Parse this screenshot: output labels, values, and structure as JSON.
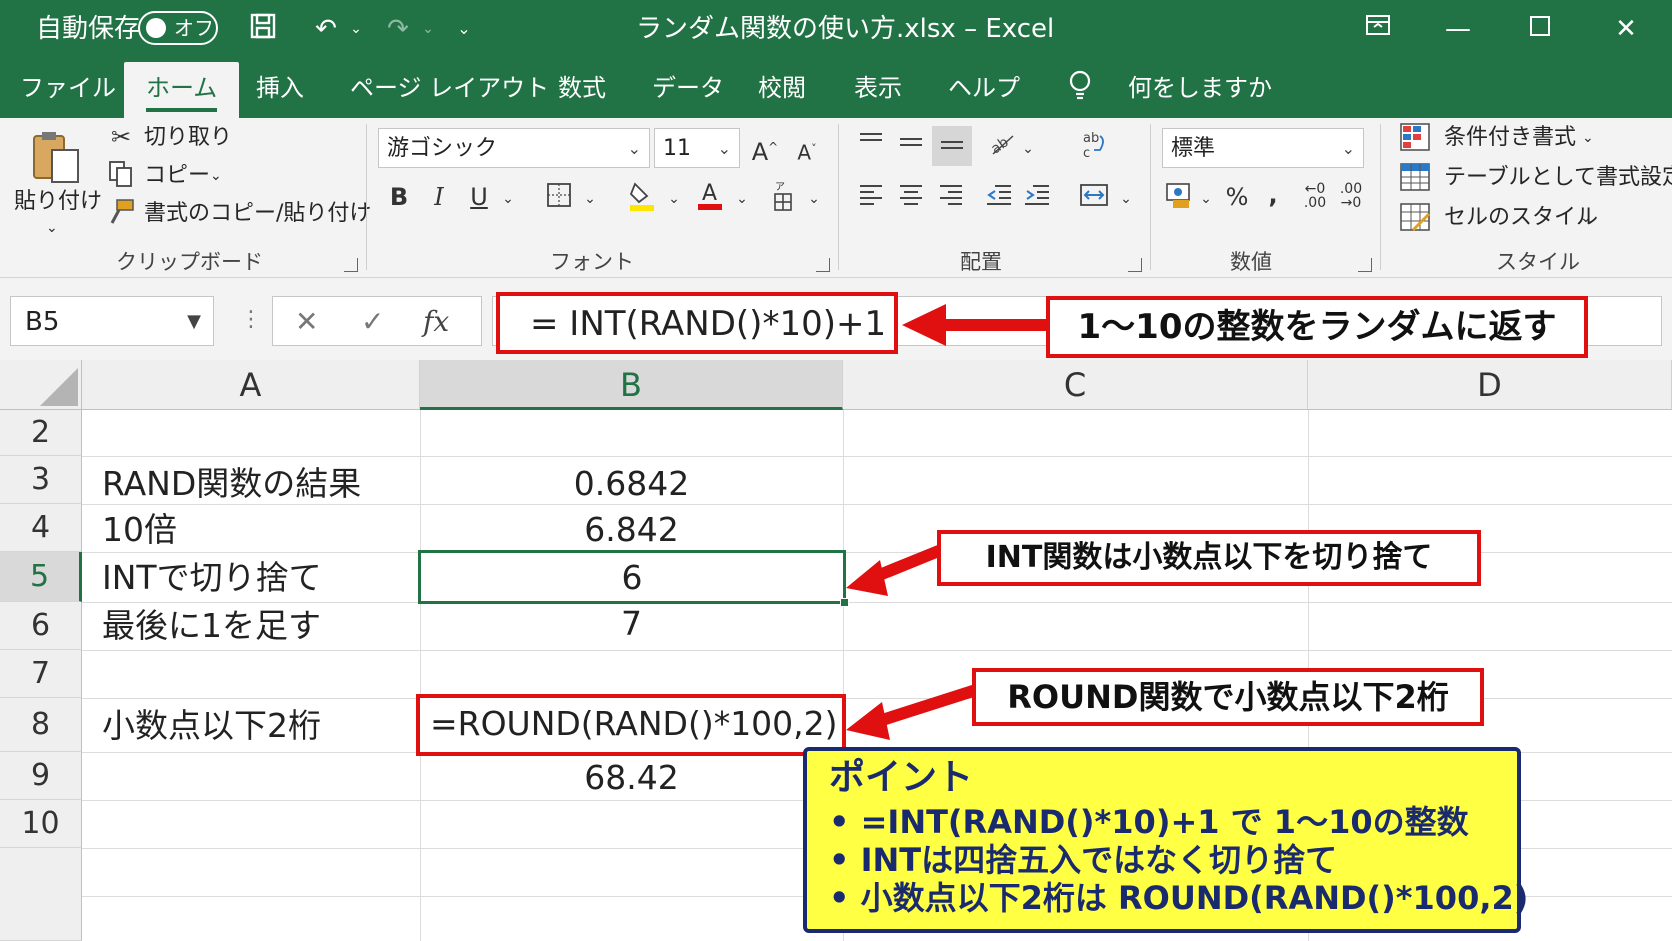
{
  "titlebar": {
    "autosave_label": "自動保存",
    "autosave_state": "オフ",
    "title": "ランダム関数の使い方.xlsx  –  Excel"
  },
  "tabs": [
    "ファイル",
    "ホーム",
    "挿入",
    "ページ レイアウト",
    "数式",
    "データ",
    "校閲",
    "表示",
    "ヘルプ"
  ],
  "active_tab": "ホーム",
  "tell_me": "何をしますか",
  "ribbon": {
    "clipboard": {
      "paste": "貼り付け",
      "cut": "切り取り",
      "copy": "コピー",
      "format_painter": "書式のコピー/貼り付け",
      "group": "クリップボード"
    },
    "font": {
      "name": "游ゴシック",
      "size": "11",
      "group": "フォント"
    },
    "alignment": {
      "group": "配置"
    },
    "number": {
      "format": "標準",
      "group": "数値"
    },
    "styles": {
      "conditional": "条件付き書式",
      "table": "テーブルとして書式設定",
      "cell_styles": "セルのスタイル",
      "group": "スタイル"
    }
  },
  "formula_bar": {
    "name_box": "B5",
    "formula": "= INT(RAND()*10)+1"
  },
  "columns": [
    "A",
    "B",
    "C",
    "D"
  ],
  "rows": [
    {
      "num": "2",
      "a": "",
      "b": ""
    },
    {
      "num": "3",
      "a": "RAND関数の結果",
      "b": "0.6842"
    },
    {
      "num": "4",
      "a": "10倍",
      "b": "6.842"
    },
    {
      "num": "5",
      "a": "INTで切り捨て",
      "b": "6"
    },
    {
      "num": "6",
      "a": "最後に1を足す",
      "b": "7"
    },
    {
      "num": "7",
      "a": "",
      "b": ""
    },
    {
      "num": "8",
      "a": "小数点以下2桁",
      "b": "=ROUND(RAND()*100,2)"
    },
    {
      "num": "9",
      "a": "",
      "b": "68.42"
    },
    {
      "num": "10",
      "a": "",
      "b": ""
    }
  ],
  "annotations": {
    "formula_note": "1〜10の整数をランダムに返す",
    "int_note": "INT関数は小数点以下を切り捨て",
    "round_note": "ROUND関数で小数点以下2桁"
  },
  "point": {
    "title": "ポイント",
    "lines": [
      "• =INT(RAND()*10)+1 で 1〜10の整数",
      "• INTは四捨五入ではなく切り捨て",
      "• 小数点以下2桁は ROUND(RAND()*100,2)"
    ]
  },
  "colors": {
    "excel_green": "#217346",
    "annotation_red": "#e01010",
    "point_bg": "#ffff44",
    "point_border": "#1a2a6e"
  }
}
